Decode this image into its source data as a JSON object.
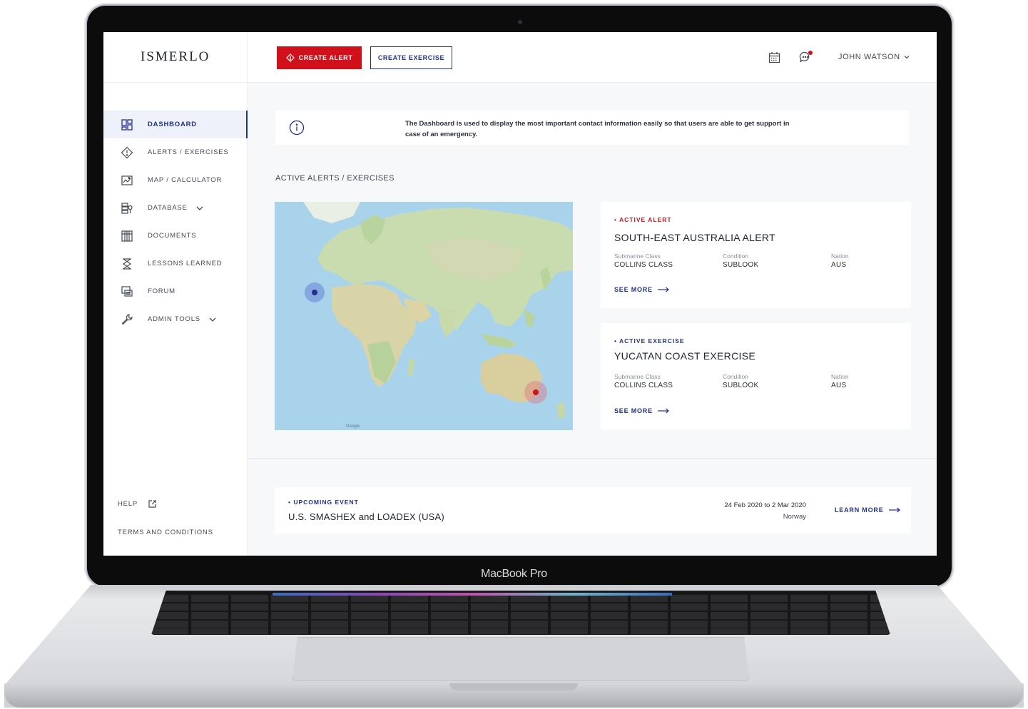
{
  "device": {
    "label": "MacBook Pro"
  },
  "app": {
    "logo": "ISMERLO"
  },
  "header": {
    "create_alert_label": "CREATE ALERT",
    "create_exercise_label": "CREATE EXERCISE",
    "user_name": "JOHN WATSON",
    "icons": [
      "calendar-icon",
      "chat-icon",
      "chevron-down-icon"
    ]
  },
  "sidebar": {
    "items": [
      {
        "label": "DASHBOARD",
        "icon": "dashboard-icon",
        "active": true
      },
      {
        "label": "ALERTS / EXERCISES",
        "icon": "alert-diamond-icon"
      },
      {
        "label": "MAP / CALCULATOR",
        "icon": "map-icon"
      },
      {
        "label": "DATABASE",
        "icon": "database-icon",
        "expandable": true
      },
      {
        "label": "DOCUMENTS",
        "icon": "documents-icon"
      },
      {
        "label": "LESSONS LEARNED",
        "icon": "lessons-icon"
      },
      {
        "label": "FORUM",
        "icon": "forum-icon"
      },
      {
        "label": "ADMIN TOOLS",
        "icon": "wrench-icon",
        "expandable": true
      }
    ],
    "help_label": "HELP",
    "terms_label": "TERMS AND CONDITIONS"
  },
  "info_banner": {
    "text": "The Dashboard is used to display the most important contact information easily so that users are able to get support in case of an emergency."
  },
  "section": {
    "title": "ACTIVE ALERTS / EXERCISES"
  },
  "map": {
    "attribution": "Google"
  },
  "cards": [
    {
      "tag": "• ACTIVE ALERT",
      "title": "SOUTH-EAST AUSTRALIA ALERT",
      "fields": [
        {
          "label": "Submarine Class",
          "value": "COLLINS CLASS"
        },
        {
          "label": "Condition",
          "value": "SUBLOOK"
        },
        {
          "label": "Nation",
          "value": "AUS"
        }
      ],
      "link": "SEE MORE"
    },
    {
      "tag": "• ACTIVE EXERCISE",
      "title": "YUCATAN COAST EXERCISE",
      "fields": [
        {
          "label": "Submarine Class",
          "value": "COLLINS CLASS"
        },
        {
          "label": "Condition",
          "value": "SUBLOOK"
        },
        {
          "label": "Nation",
          "value": "AUS"
        }
      ],
      "link": "SEE MORE"
    }
  ],
  "upcoming_event": {
    "tag": "• UPCOMING EVENT",
    "title": "U.S. SMASHEX and LOADEX (USA)",
    "start": "24 Feb 2020",
    "to": "to",
    "end": "2 Mar 2020",
    "location": "Norway",
    "link": "LEARN MORE"
  },
  "colors": {
    "accent_blue": "#22318a",
    "alert_red": "#d0101b",
    "background": "#f7f8fa"
  }
}
